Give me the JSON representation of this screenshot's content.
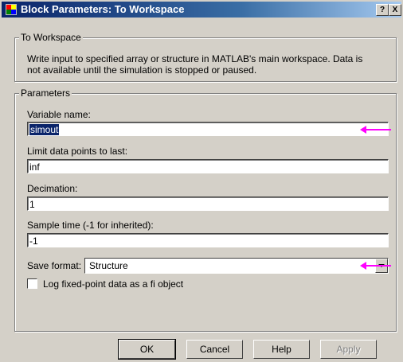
{
  "window": {
    "title": "Block Parameters: To Workspace",
    "help_label": "?",
    "close_label": "X"
  },
  "block": {
    "group_label": "To Workspace",
    "description": "Write input to specified array or structure in MATLAB's main workspace. Data is not available until the simulation is stopped or paused."
  },
  "params": {
    "group_label": "Parameters",
    "variable_name": {
      "label": "Variable name:",
      "value": "simout"
    },
    "limit": {
      "label": "Limit data points to last:",
      "value": "inf"
    },
    "decimation": {
      "label": "Decimation:",
      "value": "1"
    },
    "sample_time": {
      "label": "Sample time (-1 for inherited):",
      "value": "-1"
    },
    "save_format": {
      "label": "Save format:",
      "value": "Structure"
    },
    "log_fixed_point": {
      "label": "Log fixed-point data as a fi object",
      "checked": false
    }
  },
  "buttons": {
    "ok": "OK",
    "cancel": "Cancel",
    "help": "Help",
    "apply": "Apply"
  },
  "colors": {
    "title_bar": "#0a246a",
    "face": "#d4d0c8",
    "annotation_arrow": "#ff00ff"
  },
  "icons": {
    "window": "simulink-block-icon",
    "dropdown": "chevron-down-icon"
  }
}
